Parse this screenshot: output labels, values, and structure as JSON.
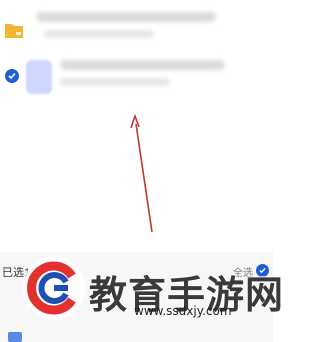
{
  "files": [
    {
      "name": "",
      "meta": "",
      "selected": false,
      "icon": "folder-icon"
    },
    {
      "name": "",
      "meta": "",
      "selected": true,
      "icon": "image-thumbnail"
    }
  ],
  "bottom_bar": {
    "selected_count_text": "已选1个项目",
    "select_all_label": "全选"
  },
  "watermark": {
    "title": "教育手游网",
    "url": "www.ssdxjy.com"
  },
  "colors": {
    "accent": "#1f5fd6",
    "folder": "#f2b533",
    "arrow": "#c0392b",
    "logo_red": "#e2312f",
    "logo_blue": "#1e4fb4"
  }
}
